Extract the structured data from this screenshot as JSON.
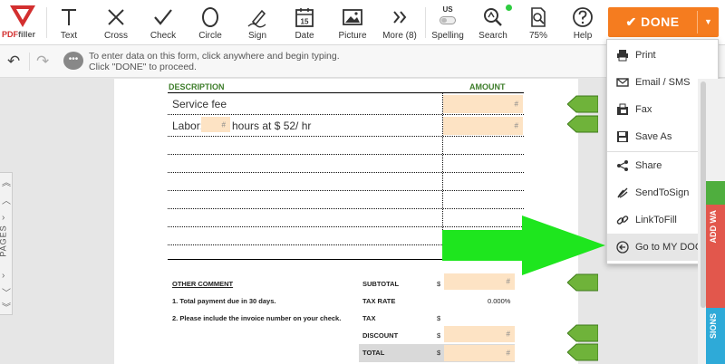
{
  "logo": {
    "text_pdf": "PDF",
    "text_filler": "filler"
  },
  "toolbar": {
    "text": "Text",
    "cross": "Cross",
    "check": "Check",
    "circle": "Circle",
    "sign": "Sign",
    "date": "Date",
    "date_day": "15",
    "picture": "Picture",
    "more": "More (8)",
    "spelling": "Spelling",
    "spelling_lang": "US",
    "search": "Search",
    "zoom": "75%",
    "help": "Help"
  },
  "done_button": {
    "label": "DONE"
  },
  "hint": {
    "text": "To enter data on this form, click anywhere and begin typing. Click \"DONE\" to proceed."
  },
  "pages_tab": {
    "label": "PAGES"
  },
  "document": {
    "col_description": "DESCRIPTION",
    "col_amount": "AMOUNT",
    "row1": "Service fee",
    "row2_prefix": "Labor:",
    "row2_suffix": "hours at $ 52/ hr",
    "field_placeholder": "#",
    "other_comment": "OTHER COMMENT",
    "comment1": "1. Total payment due in 30 days.",
    "comment2": "2. Please include the invoice number on your check.",
    "subtotal": "SUBTOTAL",
    "tax_rate": "TAX RATE",
    "tax_rate_value": "0.000%",
    "tax": "TAX",
    "discount": "DISCOUNT",
    "total": "TOTAL",
    "currency": "$"
  },
  "menu": {
    "items": [
      {
        "label": "Print",
        "icon": "printer-icon"
      },
      {
        "label": "Email / SMS",
        "icon": "envelope-icon"
      },
      {
        "label": "Fax",
        "icon": "fax-icon"
      },
      {
        "label": "Save As",
        "icon": "floppy-icon"
      },
      {
        "label": "Share",
        "icon": "share-icon"
      },
      {
        "label": "SendToSign",
        "icon": "pen-nib-icon"
      },
      {
        "label": "LinkToFill",
        "icon": "link-icon"
      },
      {
        "label": "Go to MY DOCS",
        "icon": "arrow-left-circle-icon"
      }
    ]
  },
  "right_tabs": {
    "add": "ADD WA",
    "sions": "SIONS"
  },
  "colors": {
    "accent": "#f57c1f",
    "green": "#3d7d2a",
    "arrow": "#22e622",
    "field": "#fde3c4"
  }
}
